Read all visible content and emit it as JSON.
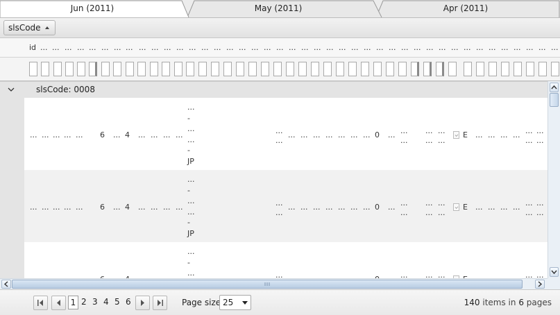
{
  "tabs": [
    {
      "label": "Jun (2011)",
      "active": true
    },
    {
      "label": "May (2011)",
      "active": false
    },
    {
      "label": "Apr (2011)",
      "active": false
    }
  ],
  "grouping": {
    "label": "slsCode",
    "sort": "ascending"
  },
  "columns": {
    "first": "id",
    "ellipsis": "..."
  },
  "group": {
    "title": "slsCode: 0008"
  },
  "row": {
    "ellipsis": "...",
    "dash": "-",
    "val6": "6",
    "val4": "4",
    "val0": "0",
    "valE": "E",
    "valJP": "JP"
  },
  "pager": {
    "pages": [
      "1",
      "2",
      "3",
      "4",
      "5",
      "6"
    ],
    "current": "1",
    "page_size_label": "Page size:",
    "page_size": "25",
    "items_total": "140",
    "items_text": " items in ",
    "pages_total": "6",
    "pages_text": " pages"
  },
  "icons": [
    "first-page-icon",
    "prev-page-icon",
    "next-page-icon",
    "last-page-icon",
    "collapse-icon",
    "sort-asc-icon",
    "dropdown-icon"
  ]
}
